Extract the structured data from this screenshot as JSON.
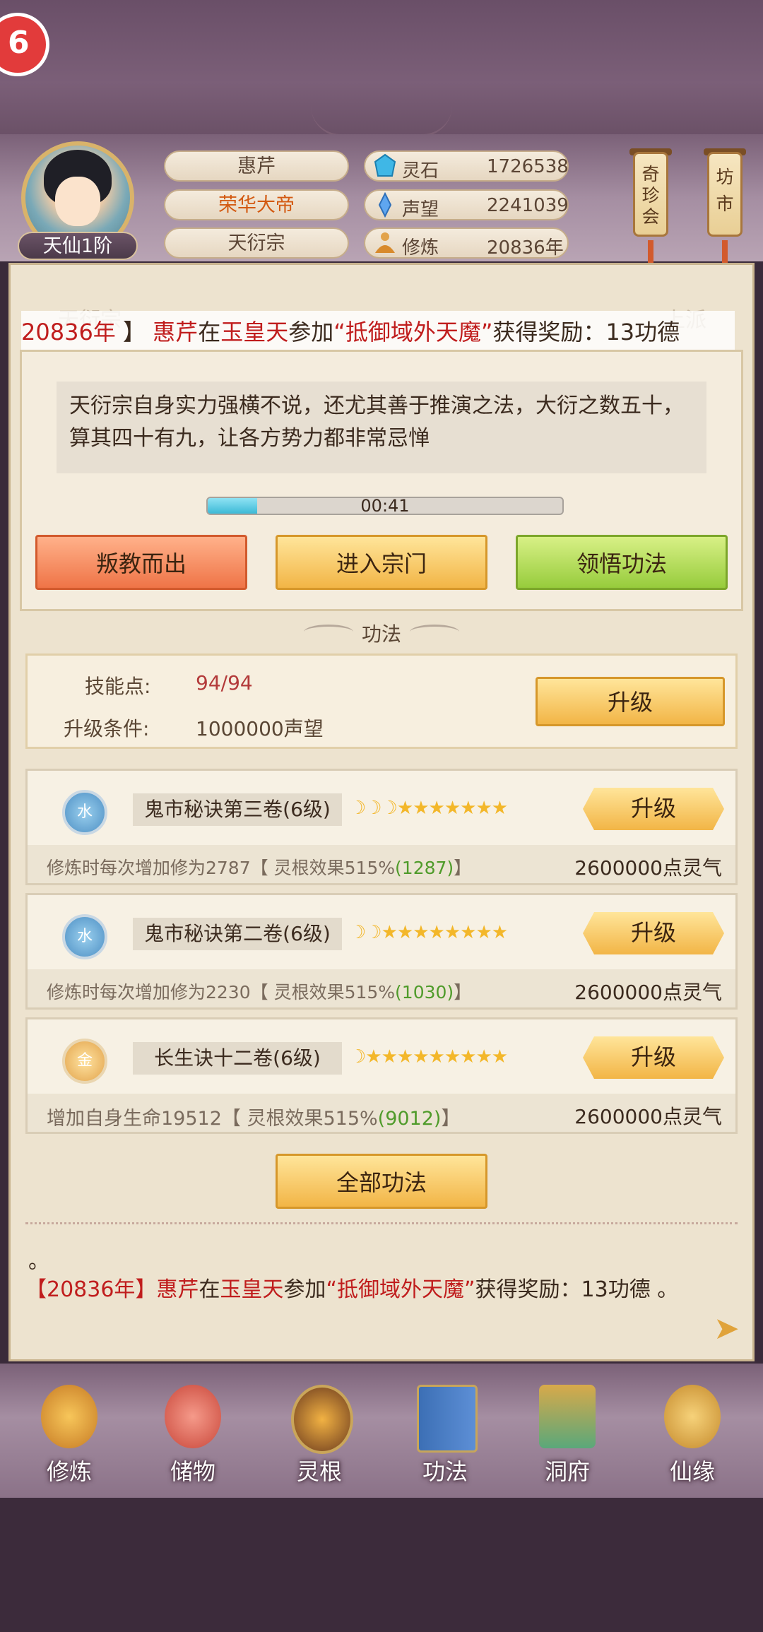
{
  "profile": {
    "rank": "天仙1阶",
    "name": "惠芹",
    "title": "荣华大帝",
    "sect": "天衍宗"
  },
  "stats": [
    {
      "label": "灵石",
      "value": "1726538",
      "icon": "spirit-stone-icon"
    },
    {
      "label": "声望",
      "value": "2241039",
      "icon": "prestige-icon"
    },
    {
      "label": "修炼",
      "value": "20836年",
      "icon": "cultivation-icon"
    }
  ],
  "side_buttons": {
    "treasure": "奇珍会",
    "market": "坊市"
  },
  "tabs": {
    "left": "天衍宗",
    "right": "上派"
  },
  "ticker": {
    "year": "20836年",
    "bracket": "】",
    "name": "惠芹",
    "at": "在",
    "place": "玉皇天",
    "join": "参加",
    "event": "“抵御域外天魔”",
    "reward": "获得奖励：13功德"
  },
  "description": "天衍宗自身实力强横不说，还尤其善于推演之法，大衍之数五十，算其四十有九，让各方势力都非常忌惮",
  "timer": {
    "text": "00:41",
    "progress": 0.14
  },
  "actions": {
    "leave": "叛教而出",
    "enter": "进入宗门",
    "comprehend": "领悟功法"
  },
  "section_title": "功法",
  "skill_points": {
    "label": "技能点:",
    "value": "94/94",
    "cond_label": "升级条件:",
    "cond_value": "1000000声望",
    "upgrade": "升级"
  },
  "techniques": [
    {
      "element": "水",
      "name": "鬼市秘诀第三卷(6级)",
      "stars": "☽☽☽★★★★★★★",
      "desc": "修炼时每次增加修为2787【 灵根效果515%",
      "desc_hl": "(1287)",
      "desc_end": "】",
      "cost": "2600000点灵气",
      "button": "升级"
    },
    {
      "element": "水",
      "name": "鬼市秘诀第二卷(6级)",
      "stars": "☽☽★★★★★★★★",
      "desc": "修炼时每次增加修为2230【 灵根效果515%",
      "desc_hl": "(1030)",
      "desc_end": "】",
      "cost": "2600000点灵气",
      "button": "升级"
    },
    {
      "element": "金",
      "name": "长生诀十二卷(6级)",
      "stars": "☽★★★★★★★★★",
      "desc": "增加自身生命19512【 灵根效果515%",
      "desc_hl": "(9012)",
      "desc_end": "】",
      "cost": "2600000点灵气",
      "button": "升级"
    }
  ],
  "all_techniques": "全部功法",
  "log": {
    "dot": "。",
    "open": "【",
    "year": "20836年",
    "close": "】",
    "name": "惠芹",
    "at": "在",
    "place": "玉皇天",
    "join": "参加",
    "event": "“抵御域外天魔”",
    "reward": "获得奖励：13功德 。"
  },
  "nav": [
    "修炼",
    "储物",
    "灵根",
    "功法",
    "洞府",
    "仙缘"
  ],
  "colors": {
    "accent_red": "#c01d1d",
    "gold_button": "#f2b546",
    "green_button": "#97cc3c",
    "red_button": "#ef7447"
  }
}
